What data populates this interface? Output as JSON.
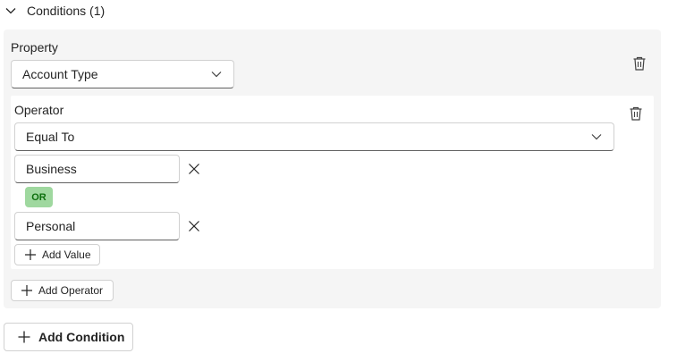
{
  "section": {
    "title": "Conditions (1)"
  },
  "condition": {
    "property_label": "Property",
    "property_value": "Account Type",
    "operator": {
      "label": "Operator",
      "value": "Equal To",
      "values": [
        {
          "value": "Business"
        },
        {
          "value": "Personal"
        }
      ],
      "or_badge": "OR",
      "add_value_label": "Add Value"
    },
    "add_operator_label": "Add Operator"
  },
  "add_condition_label": "Add Condition",
  "icons": {
    "section_toggle": "chevron-down-icon",
    "dropdown": "chevron-down-icon",
    "delete": "trash-icon",
    "remove_value": "close-icon",
    "add": "plus-icon"
  },
  "colors": {
    "card_background": "#f5f5f5",
    "or_badge_background": "#9fd89f",
    "or_badge_text": "#0e700e"
  }
}
